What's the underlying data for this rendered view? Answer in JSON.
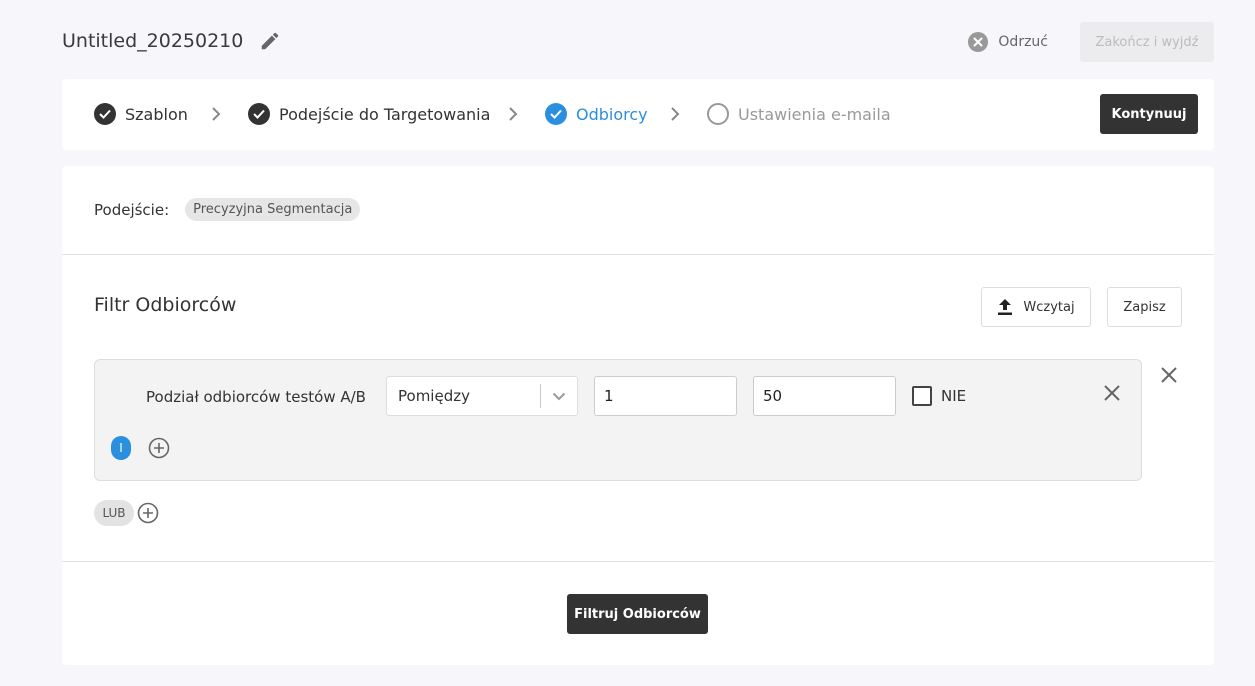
{
  "header": {
    "title": "Untitled_20250210",
    "discard_label": "Odrzuć",
    "finish_label": "Zakończ i wyjdź"
  },
  "stepper": {
    "steps": [
      {
        "label": "Szablon",
        "state": "done"
      },
      {
        "label": "Podejście do Targetowania",
        "state": "done"
      },
      {
        "label": "Odbiorcy",
        "state": "active"
      },
      {
        "label": "Ustawienia e-maila",
        "state": "pending"
      }
    ],
    "continue_label": "Kontynuuj"
  },
  "approach": {
    "label": "Podejście:",
    "value": "Precyzyjna Segmentacja"
  },
  "filter": {
    "title": "Filtr Odbiorców",
    "upload_label": "Wczytaj",
    "save_label": "Zapisz",
    "condition": {
      "field": "Podział odbiorców testów A/B",
      "operator": "Pomiędzy",
      "value_from": "1",
      "value_to": "50",
      "not_label": "NIE",
      "not_checked": false
    },
    "and_label": "I",
    "or_label": "LUB",
    "apply_label": "Filtruj Odbiorców"
  },
  "colors": {
    "accent": "#2b8fe0",
    "dark_button": "#333333",
    "disabled_button": "#ececef"
  }
}
